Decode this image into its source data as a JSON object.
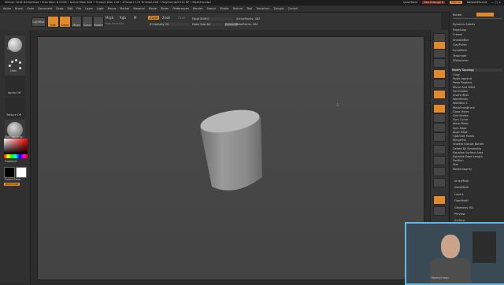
{
  "titlebar": {
    "text": "ZBrush 2018   DemoHead   • Free Mem 6.23GB • Active Mem 642 • Scratch Disk 100 • ZTime▸1.170 Timer▸0.006 • PolyCount▸3.512 KP • MeshCount▸1",
    "quicksave": "QuickSave",
    "see_through": "See-through 0",
    "menus_label": "Menus",
    "default_script": "DefaultZScript"
  },
  "menubar": [
    "Alpha",
    "Brush",
    "Color",
    "Document",
    "Draw",
    "Edit",
    "File",
    "Layer",
    "Light",
    "Macro",
    "Marker",
    "Material",
    "Movie",
    "Picker",
    "Preferences",
    "Render",
    "Stencil",
    "Stroke",
    "Texture",
    "Tool",
    "Transform",
    "Zplugin",
    "Zscript"
  ],
  "toolbar": {
    "projection_master": "Projection Master",
    "lightbox": "LightBox",
    "edit": "Edit",
    "draw": "Draw",
    "move": "Move",
    "scale": "Scale",
    "rotate": "Rotate",
    "mrgb": "Mrgb",
    "rgb": "Rgb",
    "m": "M",
    "zadd": "Zadd",
    "zsub": "Zsub",
    "zcut": "Zcut",
    "z_intensity": "Z Intensity 25",
    "focal_shift": "Focal Shift 0",
    "draw_size": "Draw Size 64",
    "dynamic": "Dynamic",
    "active_points": "ActivePoints: 482",
    "total_points": "TotalPoints: 482",
    "rgb_intensity": "Rgb Intensity"
  },
  "lefttray": {
    "brush": "Standard",
    "stroke": "Dots",
    "alpha": "Alpha Off",
    "texture": "Texture Off",
    "material": "MatCap Gray",
    "gradient": "Gradient",
    "switch_color": "SwitchColor",
    "alternate": "Alternate"
  },
  "rightshelf": [
    "BPR",
    "SPix 3",
    "Scroll",
    "Zoom",
    "Actual",
    "AAHalf",
    "Persp",
    "Floor",
    "Local",
    "Frame",
    "Move",
    "Scale",
    "Rotate",
    "Line Fill",
    "PolyF",
    "Transp",
    "Ghost",
    "Solo",
    "Xpose"
  ],
  "palette": {
    "tabs": [
      "Border",
      "Size",
      "Dynamic Subdiv"
    ],
    "items_top": [
      "Dynamic Subdiv",
      "EdgeLoop",
      "Crease",
      "ShadowBox",
      "ClayPolish",
      "DynaMesh",
      "Tessimate",
      "ZRemesher"
    ],
    "modify_topology": "Modify Topology",
    "mt_items": [
      "Copy",
      "Paste Append",
      "Paste Replace",
      "Mirror And Weld",
      "Del Hidden",
      "Insert Mesh",
      "WeldPoints",
      "WeldDist 1",
      "MeshFromBrush",
      "Close Holes",
      "Grid Divide",
      "Sym Curve",
      "Micro Mesh",
      "Spin Edge",
      "Align Edge",
      "Optimize Points",
      "MergeTris",
      "Unweld Groups Border",
      "Delete By Symmetry",
      "Equalize Surface Area",
      "Equalize Edge Length",
      "Position",
      "Size",
      "MeshIntegrity"
    ],
    "subpalettes": [
      "ArrayMesh",
      "NanoMesh",
      "Layers",
      "FiberMesh",
      "Geometry HD",
      "Preview",
      "Surface",
      "Deformation",
      "Masking"
    ]
  },
  "webcam": {
    "label": "Normal map"
  },
  "colors": {
    "accent": "#e08a2a",
    "panel": "#303030",
    "canvas": "#484848",
    "webcam_border": "#5fb8e8"
  }
}
